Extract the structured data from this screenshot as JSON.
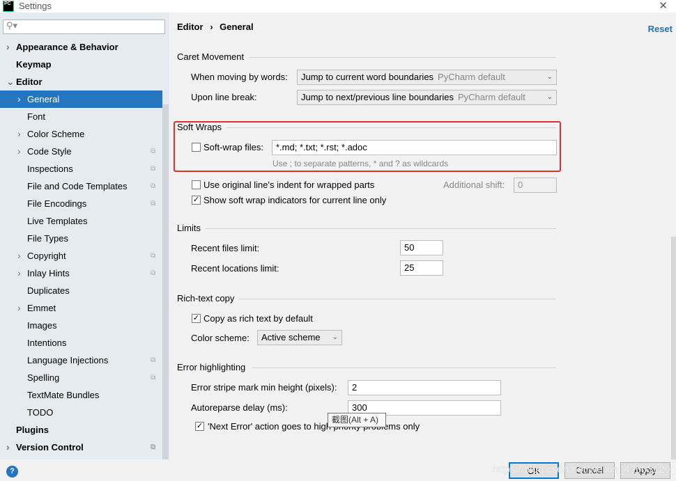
{
  "window": {
    "title": "Settings",
    "logo": "PC",
    "close_icon": "close-icon"
  },
  "search": {
    "placeholder": "",
    "icon": "search-icon"
  },
  "sidebar": {
    "items": [
      {
        "label": "Appearance & Behavior",
        "bold": true,
        "expand": true
      },
      {
        "label": "Keymap",
        "bold": true
      },
      {
        "label": "Editor",
        "bold": true,
        "expanded": true
      },
      {
        "label": "General",
        "selected": true,
        "expand": true
      },
      {
        "label": "Font"
      },
      {
        "label": "Color Scheme",
        "expand": true
      },
      {
        "label": "Code Style",
        "expand": true,
        "copy": true
      },
      {
        "label": "Inspections",
        "copy": true
      },
      {
        "label": "File and Code Templates",
        "copy": true
      },
      {
        "label": "File Encodings",
        "copy": true
      },
      {
        "label": "Live Templates"
      },
      {
        "label": "File Types"
      },
      {
        "label": "Copyright",
        "expand": true,
        "copy": true
      },
      {
        "label": "Inlay Hints",
        "expand": true,
        "copy": true
      },
      {
        "label": "Duplicates"
      },
      {
        "label": "Emmet",
        "expand": true
      },
      {
        "label": "Images"
      },
      {
        "label": "Intentions"
      },
      {
        "label": "Language Injections",
        "copy": true
      },
      {
        "label": "Spelling",
        "copy": true
      },
      {
        "label": "TextMate Bundles"
      },
      {
        "label": "TODO"
      },
      {
        "label": "Plugins",
        "bold": true
      },
      {
        "label": "Version Control",
        "bold": true,
        "expand": true,
        "copy": true
      }
    ]
  },
  "header": {
    "crumb1": "Editor",
    "sep": "›",
    "crumb2": "General",
    "reset": "Reset"
  },
  "caret": {
    "title": "Caret Movement",
    "words_label": "When moving by words:",
    "words_value": "Jump to current word boundaries",
    "words_hint": "PyCharm default",
    "break_label": "Upon line break:",
    "break_value": "Jump to next/previous line boundaries",
    "break_hint": "PyCharm default"
  },
  "softwraps": {
    "title": "Soft Wraps",
    "files_label": "Soft-wrap files:",
    "files_checked": false,
    "files_value": "*.md; *.txt; *.rst; *.adoc",
    "help": "Use ; to separate patterns, * and ? as wildcards",
    "indent_label": "Use original line's indent for wrapped parts",
    "indent_checked": false,
    "shift_label": "Additional shift:",
    "shift_value": "0",
    "indicators_label": "Show soft wrap indicators for current line only",
    "indicators_checked": true
  },
  "limits": {
    "title": "Limits",
    "recent_files_label": "Recent files limit:",
    "recent_files_value": "50",
    "recent_loc_label": "Recent locations limit:",
    "recent_loc_value": "25"
  },
  "richtext": {
    "title": "Rich-text copy",
    "copy_label": "Copy as rich text by default",
    "copy_checked": true,
    "scheme_label": "Color scheme:",
    "scheme_value": "Active scheme"
  },
  "errors": {
    "title": "Error highlighting",
    "stripe_label": "Error stripe mark min height (pixels):",
    "stripe_value": "2",
    "delay_label": "Autoreparse delay (ms):",
    "delay_value": "300",
    "next_label": "'Next Error' action goes to high priority problems only",
    "next_checked": true
  },
  "tooltip": "截图(Alt + A)",
  "buttons": {
    "ok": "OK",
    "cancel": "Cancel",
    "apply": "Apply",
    "help": "?"
  },
  "watermark": "https://blog.csdn.net/weixin_42603129",
  "colors": {
    "accent": "#2675bf",
    "highlight_box": "#e52d2d",
    "link": "#2470b3"
  }
}
